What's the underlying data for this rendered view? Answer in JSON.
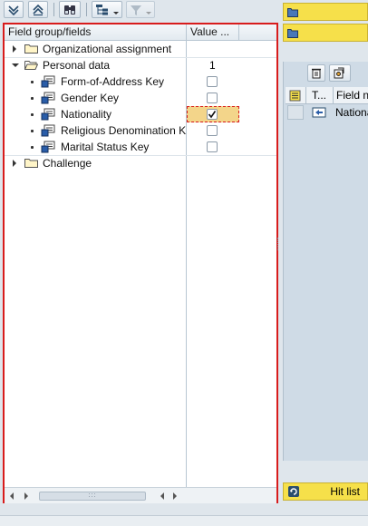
{
  "toolbar": {
    "buttons": [
      {
        "name": "expand-all-icon"
      },
      {
        "name": "collapse-all-icon"
      },
      {
        "name": "find-icon"
      },
      {
        "name": "tree-layout-icon"
      },
      {
        "name": "filter-icon"
      }
    ]
  },
  "tree": {
    "header": {
      "field_col": "Field group/fields",
      "value_col": "Value ..."
    },
    "rows": [
      {
        "label": "Organizational assignment",
        "type": "group",
        "expanded": false,
        "value": ""
      },
      {
        "label": "Personal data",
        "type": "group",
        "expanded": true,
        "value": "1"
      },
      {
        "label": "Form-of-Address Key",
        "type": "field",
        "checked": false
      },
      {
        "label": "Gender Key",
        "type": "field",
        "checked": false
      },
      {
        "label": "Nationality",
        "type": "field",
        "checked": true,
        "selected": true
      },
      {
        "label": "Religious Denomination Key",
        "type": "field",
        "checked": false
      },
      {
        "label": "Marital Status Key",
        "type": "field",
        "checked": false
      },
      {
        "label": "Challenge",
        "type": "group",
        "expanded": false,
        "value": ""
      }
    ]
  },
  "right_panel": {
    "grid_header": {
      "col1": "T...",
      "col2": "Field na"
    },
    "grid_rows": [
      {
        "col2": "Nationa"
      }
    ],
    "hit_list_label": "Hit list"
  },
  "colors": {
    "selection_border": "#d81c1c",
    "yellow_button": "#f6e04a",
    "selected_cell": "#f3d58a"
  }
}
